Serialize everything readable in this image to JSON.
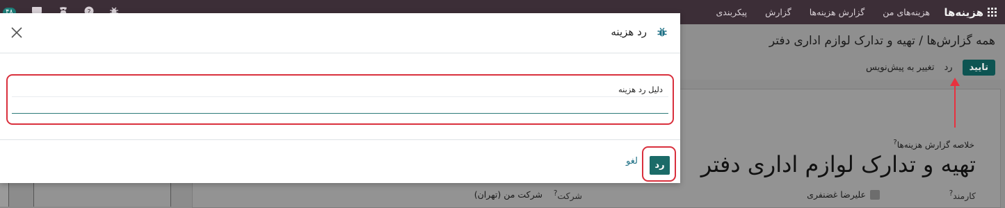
{
  "topbar": {
    "app_name": "هزینه‌ها",
    "menu": [
      "هزینه‌های من",
      "گزارش هزینه‌ها",
      "گزارش",
      "پیکربندی"
    ],
    "badge": "۴۸",
    "icons": [
      "grid-icon",
      "chat-icon",
      "phone-icon",
      "help-icon",
      "bug-icon"
    ]
  },
  "breadcrumb": {
    "parent": "همه گزارش‌ها",
    "separator": "/",
    "current": "تهیه و تدارک لوازم اداری دفتر"
  },
  "actions": {
    "approve": "تایید",
    "reject": "رد",
    "reset": "تغییر به پیش‌نویس"
  },
  "form": {
    "summary_label": "خلاصه گزارش هزینه‌ها",
    "summary_value": "تهیه و تدارک لوازم اداری دفتر",
    "employee_label": "کارمند",
    "employee_value": "علیرضا غضنفری",
    "company_label": "شرکت",
    "company_value": "شرکت من (تهران)",
    "help_mark": "?"
  },
  "modal": {
    "title": "رد هزینه",
    "field_label": "دلیل رد هزینه",
    "field_value": "",
    "reject_button": "رد",
    "cancel_button": "لغو"
  },
  "colors": {
    "primary": "#1b6b68",
    "highlight": "#d9303d",
    "topbar": "#3c2e37"
  }
}
